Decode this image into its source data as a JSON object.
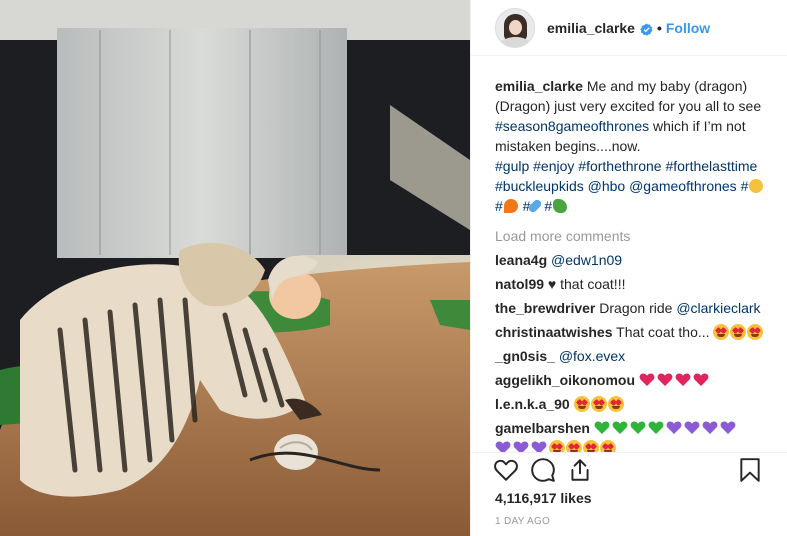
{
  "post": {
    "username": "emilia_clarke",
    "follow_label": "Follow",
    "dot": "•",
    "caption_user": "emilia_clarke",
    "caption_text": " Me and my baby (dragon) (Dragon) just very excited for you all to see ",
    "hashtag1": "#season8gameofthrones",
    "caption_text2": " which if I’m not mistaken begins....now.",
    "hashtag_line": "#gulp #enjoy #forthethrone #forthelasttime #buckleupkids @hbo @gameofthrones #",
    "hashtag_end1": "#",
    "hashtag_end2": " #",
    "hashtag_end3": " #",
    "load_more": "Load more comments",
    "likes": "4,116,917 likes",
    "time": "1 DAY AGO"
  },
  "comments": [
    {
      "user": "leana4g",
      "text": "@edw1n09"
    },
    {
      "user": "natol99",
      "text": "♥ that coat!!!"
    },
    {
      "user": "the_brewdriver",
      "text": "Dragon ride",
      "mention": "@clarkieclark"
    },
    {
      "user": "christinaatwishes",
      "text": "That coat tho..."
    },
    {
      "user": "_gn0sis_",
      "mention": "@fox.evex"
    },
    {
      "user": "aggelikh_oikonomou"
    },
    {
      "user": "l.e.n.k.a_90"
    },
    {
      "user": "gamelbarshen"
    }
  ],
  "icons": [
    "verified-badge-icon",
    "heart-icon",
    "comment-icon",
    "share-icon",
    "bookmark-icon"
  ],
  "colors": {
    "follow": "#3897f0",
    "hashtag": "#003569",
    "muted": "#999999",
    "text": "#262626"
  }
}
